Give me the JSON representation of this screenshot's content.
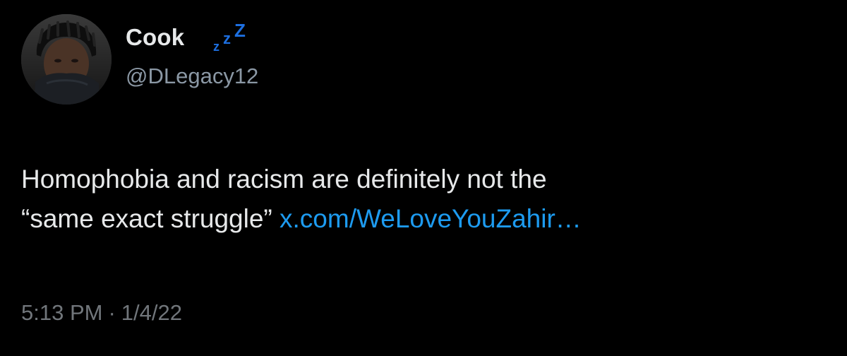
{
  "author": {
    "display_name": "Cook",
    "status_icon": "zzz-sleep-icon",
    "handle": "@DLegacy12"
  },
  "tweet": {
    "text_line1": "Homophobia and racism are definitely not the",
    "text_line2": "“same exact struggle”",
    "link": "x.com/WeLoveYouZahir…"
  },
  "meta": {
    "time": "5:13 PM",
    "separator": "·",
    "date": "1/4/22"
  },
  "colors": {
    "background": "#000000",
    "text": "#e7e9ea",
    "secondary": "#8b98a5",
    "link": "#1d9bf0",
    "zzz": "#1d6fe0"
  }
}
